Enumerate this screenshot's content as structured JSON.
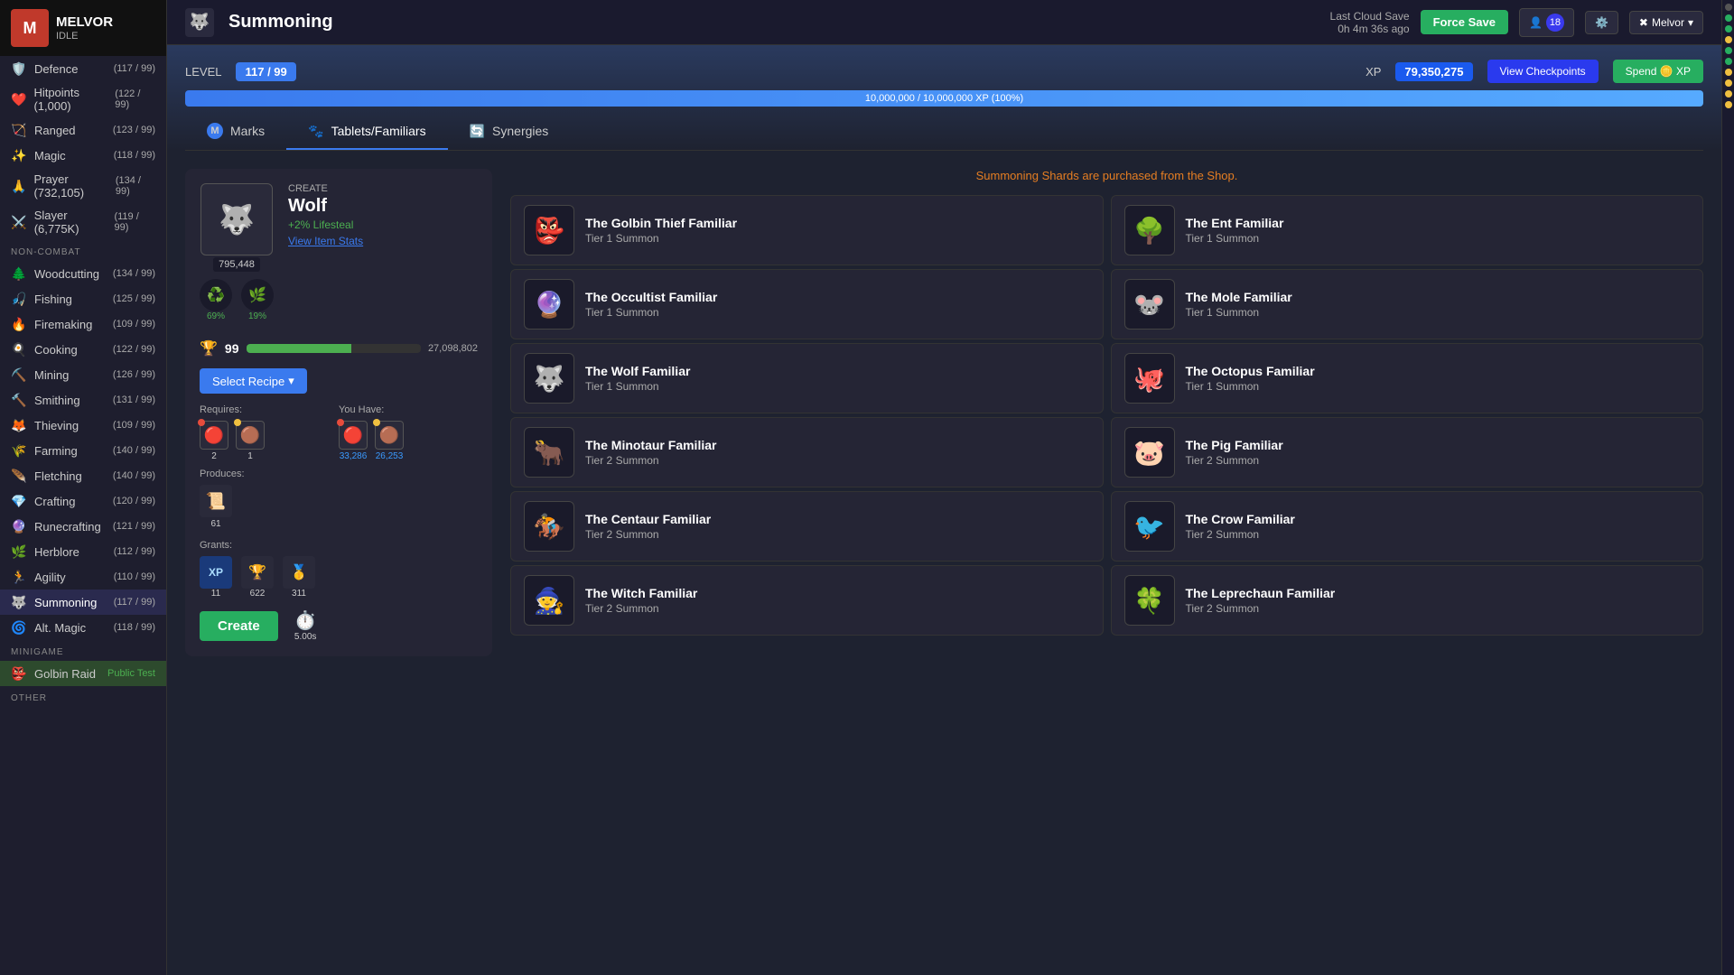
{
  "app": {
    "name": "MELVOR",
    "sub": "IDLE",
    "page_title": "Summoning"
  },
  "topbar": {
    "cloud_save_label": "Last Cloud Save",
    "cloud_save_time": "0h 4m 36s ago",
    "force_save": "Force Save",
    "user_count": "18",
    "user_name": "Melvor"
  },
  "sidebar": {
    "combat": [
      {
        "id": "defence",
        "label": "Defence",
        "icon": "🛡️",
        "badge": "(117 / 99)"
      },
      {
        "id": "hitpoints",
        "label": "Hitpoints",
        "icon": "❤️",
        "badge": "(1,000)",
        "level": "(122 / 99)"
      },
      {
        "id": "ranged",
        "label": "Ranged",
        "icon": "🏹",
        "badge": "(123 / 99)"
      },
      {
        "id": "magic",
        "label": "Magic",
        "icon": "✨",
        "badge": "(118 / 99)"
      },
      {
        "id": "prayer",
        "label": "Prayer",
        "icon": "🙏",
        "badge": "(732,105)",
        "level": "(134 / 99)"
      },
      {
        "id": "slayer",
        "label": "Slayer",
        "icon": "⚔️",
        "badge": "(6,775K)",
        "level": "(119 / 99)"
      }
    ],
    "non_combat_label": "NON-COMBAT",
    "non_combat": [
      {
        "id": "woodcutting",
        "label": "Woodcutting",
        "icon": "🌲",
        "badge": "(134 / 99)"
      },
      {
        "id": "fishing",
        "label": "Fishing",
        "icon": "🎣",
        "badge": "(125 / 99)"
      },
      {
        "id": "firemaking",
        "label": "Firemaking",
        "icon": "🔥",
        "badge": "(109 / 99)"
      },
      {
        "id": "cooking",
        "label": "Cooking",
        "icon": "🍳",
        "badge": "(122 / 99)"
      },
      {
        "id": "mining",
        "label": "Mining",
        "icon": "⛏️",
        "badge": "(126 / 99)"
      },
      {
        "id": "smithing",
        "label": "Smithing",
        "icon": "🔨",
        "badge": "(131 / 99)"
      },
      {
        "id": "thieving",
        "label": "Thieving",
        "icon": "🦊",
        "badge": "(109 / 99)"
      },
      {
        "id": "farming",
        "label": "Farming",
        "icon": "🌾",
        "badge": "(140 / 99)"
      },
      {
        "id": "fletching",
        "label": "Fletching",
        "icon": "🪶",
        "badge": "(140 / 99)"
      },
      {
        "id": "crafting",
        "label": "Crafting",
        "icon": "💎",
        "badge": "(120 / 99)"
      },
      {
        "id": "runecrafting",
        "label": "Runecrafting",
        "icon": "🔮",
        "badge": "(121 / 99)"
      },
      {
        "id": "herblore",
        "label": "Herblore",
        "icon": "🌿",
        "badge": "(112 / 99)"
      },
      {
        "id": "agility",
        "label": "Agility",
        "icon": "🏃",
        "badge": "(110 / 99)"
      },
      {
        "id": "summoning",
        "label": "Summoning",
        "icon": "🐺",
        "badge": "(117 / 99)",
        "active": true
      },
      {
        "id": "alt_magic",
        "label": "Alt. Magic",
        "icon": "🌀",
        "badge": "(118 / 99)"
      }
    ],
    "minigame_label": "MINIGAME",
    "minigame": [
      {
        "id": "goblin_raid",
        "label": "Golbin Raid",
        "icon": "👺",
        "badge": "Public Test"
      }
    ],
    "other_label": "OTHER"
  },
  "skill": {
    "level_label": "LEVEL",
    "level_value": "117 / 99",
    "xp_label": "XP",
    "xp_value": "79,350,275",
    "xp_bar_text": "10,000,000 / 10,000,000 XP (100%)",
    "xp_bar_pct": 100,
    "view_checkpoints": "View Checkpoints",
    "spend_xp": "Spend 🪙 XP",
    "tabs": [
      {
        "id": "marks",
        "label": "Marks",
        "icon": "M"
      },
      {
        "id": "tablets_familiars",
        "label": "Tablets/Familiars",
        "icon": "🐾",
        "active": true
      },
      {
        "id": "synergies",
        "label": "Synergies",
        "icon": "🔄"
      }
    ]
  },
  "craft": {
    "create_label": "CREATE",
    "item_name": "Wolf",
    "item_bonus": "+2% Lifesteal",
    "view_stats": "View Item Stats",
    "item_icon": "🐺",
    "item_count": "795,448",
    "mastery_pct1": "69%",
    "mastery_pct2": "19%",
    "progress_level": "99",
    "progress_xp": "27,098,802",
    "progress_pct": 60,
    "select_recipe": "Select Recipe",
    "requires_label": "Requires:",
    "you_have_label": "You Have:",
    "req_items": [
      {
        "icon": "🔴",
        "count": "2",
        "dot": "red"
      },
      {
        "icon": "🟤",
        "count": "1",
        "dot": "gold"
      }
    ],
    "have_items": [
      {
        "icon": "🔴",
        "count": "33,286",
        "dot": "red",
        "color": "blue"
      },
      {
        "icon": "🟤",
        "count": "26,253",
        "dot": "gold",
        "color": "blue"
      }
    ],
    "produces_label": "Produces:",
    "produces_icon": "📜",
    "produces_count": "61",
    "grants_label": "Grants:",
    "grants": [
      {
        "icon": "✨",
        "label": "XP",
        "value": "11"
      },
      {
        "icon": "🏆",
        "label": "",
        "value": "622"
      },
      {
        "icon": "🥇",
        "label": "",
        "value": "311"
      }
    ],
    "create_btn": "Create",
    "timer": "5.00s"
  },
  "familiars": {
    "shards_notice": "Summoning Shards are purchased from the Shop.",
    "items": [
      {
        "col": 0,
        "name": "The Golbin Thief Familiar",
        "tier": "Tier 1 Summon",
        "icon": "👺"
      },
      {
        "col": 1,
        "name": "The Ent Familiar",
        "tier": "Tier 1 Summon",
        "icon": "🌳"
      },
      {
        "col": 0,
        "name": "The Occultist Familiar",
        "tier": "Tier 1 Summon",
        "icon": "🔮"
      },
      {
        "col": 1,
        "name": "The Mole Familiar",
        "tier": "Tier 1 Summon",
        "icon": "🐭"
      },
      {
        "col": 0,
        "name": "The Wolf Familiar",
        "tier": "Tier 1 Summon",
        "icon": "🐺"
      },
      {
        "col": 1,
        "name": "The Octopus Familiar",
        "tier": "Tier 1 Summon",
        "icon": "🐙"
      },
      {
        "col": 0,
        "name": "The Minotaur Familiar",
        "tier": "Tier 2 Summon",
        "icon": "🐂"
      },
      {
        "col": 1,
        "name": "The Pig Familiar",
        "tier": "Tier 2 Summon",
        "icon": "🐷"
      },
      {
        "col": 0,
        "name": "The Centaur Familiar",
        "tier": "Tier 2 Summon",
        "icon": "🏇"
      },
      {
        "col": 1,
        "name": "The Crow Familiar",
        "tier": "Tier 2 Summon",
        "icon": "🐦"
      },
      {
        "col": 0,
        "name": "The Witch Familiar",
        "tier": "Tier 2 Summon",
        "icon": "🧙"
      },
      {
        "col": 1,
        "name": "The Leprechaun Familiar",
        "tier": "Tier 2 Summon",
        "icon": "🍀"
      }
    ]
  }
}
